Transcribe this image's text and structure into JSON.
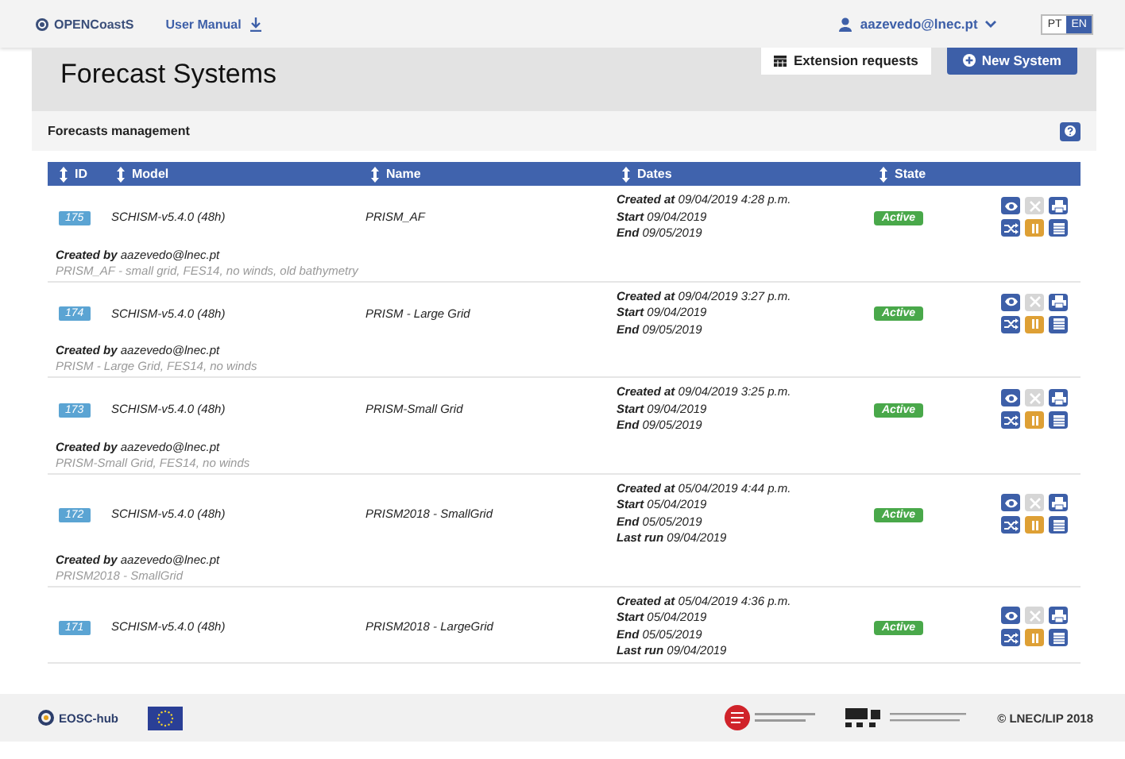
{
  "navbar": {
    "brand": "OPENCoastS",
    "manual_link": "User Manual",
    "user": "aazevedo@lnec.pt",
    "languages": [
      {
        "label": "PT",
        "selected": false
      },
      {
        "label": "EN",
        "selected": true
      }
    ]
  },
  "header": {
    "title": "Forecast Systems",
    "buttons": [
      {
        "kind": "plain",
        "label": "Extension requests"
      },
      {
        "kind": "primary",
        "label": "New System"
      }
    ]
  },
  "panel": {
    "title": "Forecasts management"
  },
  "table": {
    "columns": [
      "ID",
      "Model",
      "Name",
      "Dates",
      "State"
    ],
    "rows": [
      {
        "id": "175",
        "model": "SCHISM-v5.4.0 (48h)",
        "name": "PRISM_AF",
        "dates": [
          {
            "label": "Created at",
            "value": "09/04/2019 4:28 p.m."
          },
          {
            "label": "Start",
            "value": "09/04/2019"
          },
          {
            "label": "End",
            "value": "09/05/2019"
          }
        ],
        "state": "Active",
        "created_by_label": "Created by",
        "created_by": "aazevedo@lnec.pt",
        "description": "PRISM_AF - small grid, FES14, no winds, old bathymetry"
      },
      {
        "id": "174",
        "model": "SCHISM-v5.4.0 (48h)",
        "name": "PRISM - Large Grid",
        "dates": [
          {
            "label": "Created at",
            "value": "09/04/2019 3:27 p.m."
          },
          {
            "label": "Start",
            "value": "09/04/2019"
          },
          {
            "label": "End",
            "value": "09/05/2019"
          }
        ],
        "state": "Active",
        "created_by_label": "Created by",
        "created_by": "aazevedo@lnec.pt",
        "description": "PRISM - Large Grid, FES14, no winds"
      },
      {
        "id": "173",
        "model": "SCHISM-v5.4.0 (48h)",
        "name": "PRISM-Small Grid",
        "dates": [
          {
            "label": "Created at",
            "value": "09/04/2019 3:25 p.m."
          },
          {
            "label": "Start",
            "value": "09/04/2019"
          },
          {
            "label": "End",
            "value": "09/05/2019"
          }
        ],
        "state": "Active",
        "created_by_label": "Created by",
        "created_by": "aazevedo@lnec.pt",
        "description": "PRISM-Small Grid, FES14, no winds"
      },
      {
        "id": "172",
        "model": "SCHISM-v5.4.0 (48h)",
        "name": "PRISM2018 - SmallGrid",
        "dates": [
          {
            "label": "Created at",
            "value": "05/04/2019 4:44 p.m."
          },
          {
            "label": "Start",
            "value": "05/04/2019"
          },
          {
            "label": "End",
            "value": "05/05/2019"
          },
          {
            "label": "Last run",
            "value": "09/04/2019"
          }
        ],
        "state": "Active",
        "created_by_label": "Created by",
        "created_by": "aazevedo@lnec.pt",
        "description": "PRISM2018 - SmallGrid"
      },
      {
        "id": "171",
        "model": "SCHISM-v5.4.0 (48h)",
        "name": "PRISM2018 - LargeGrid",
        "dates": [
          {
            "label": "Created at",
            "value": "05/04/2019 4:36 p.m."
          },
          {
            "label": "Start",
            "value": "05/04/2019"
          },
          {
            "label": "End",
            "value": "05/05/2019"
          },
          {
            "label": "Last run",
            "value": "09/04/2019"
          }
        ],
        "state": "Active"
      }
    ]
  },
  "footer": {
    "partner": "EOSC-hub",
    "copyright": "© LNEC/LIP 2018"
  }
}
